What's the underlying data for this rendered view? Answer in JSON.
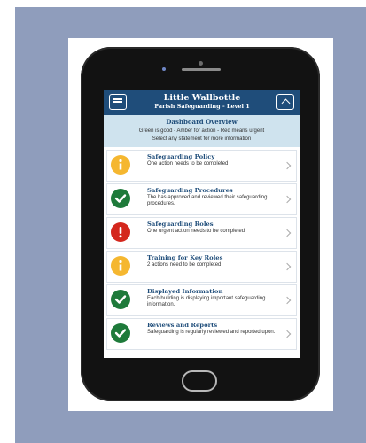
{
  "header": {
    "title": "Little Wallbottle",
    "subtitle": "Parish Safeguarding - Level 1",
    "menu_icon": "menu-icon",
    "up_icon": "chevron-up-icon",
    "color": "#1f4d7a"
  },
  "overview": {
    "title": "Dashboard Overview",
    "legend": "Green is good - Amber for action - Red means urgent",
    "instruction": "Select any statement for more information",
    "color": "#cfe3ee"
  },
  "status_colors": {
    "amber": "#f5b730",
    "green": "#1e7a3a",
    "red": "#d4271d"
  },
  "items": [
    {
      "title": "Safeguarding Policy",
      "description": "One action needs to be completed",
      "status": "amber",
      "icon": "info-icon"
    },
    {
      "title": "Safeguarding Procedures",
      "description": "The has approved and reviewed their safeguarding procedures.",
      "status": "green",
      "icon": "check-icon"
    },
    {
      "title": "Safeguarding Roles",
      "description": "One urgent action needs to be completed",
      "status": "red",
      "icon": "exclamation-icon"
    },
    {
      "title": "Training for Key Roles",
      "description": "2 actions need to be completed",
      "status": "amber",
      "icon": "info-icon"
    },
    {
      "title": "Displayed Information",
      "description": "Each building is displaying important safeguarding information.",
      "status": "green",
      "icon": "check-icon"
    },
    {
      "title": "Reviews and Reports",
      "description": "Safeguarding is regularly reviewed and reported upon.",
      "status": "green",
      "icon": "check-icon"
    }
  ]
}
